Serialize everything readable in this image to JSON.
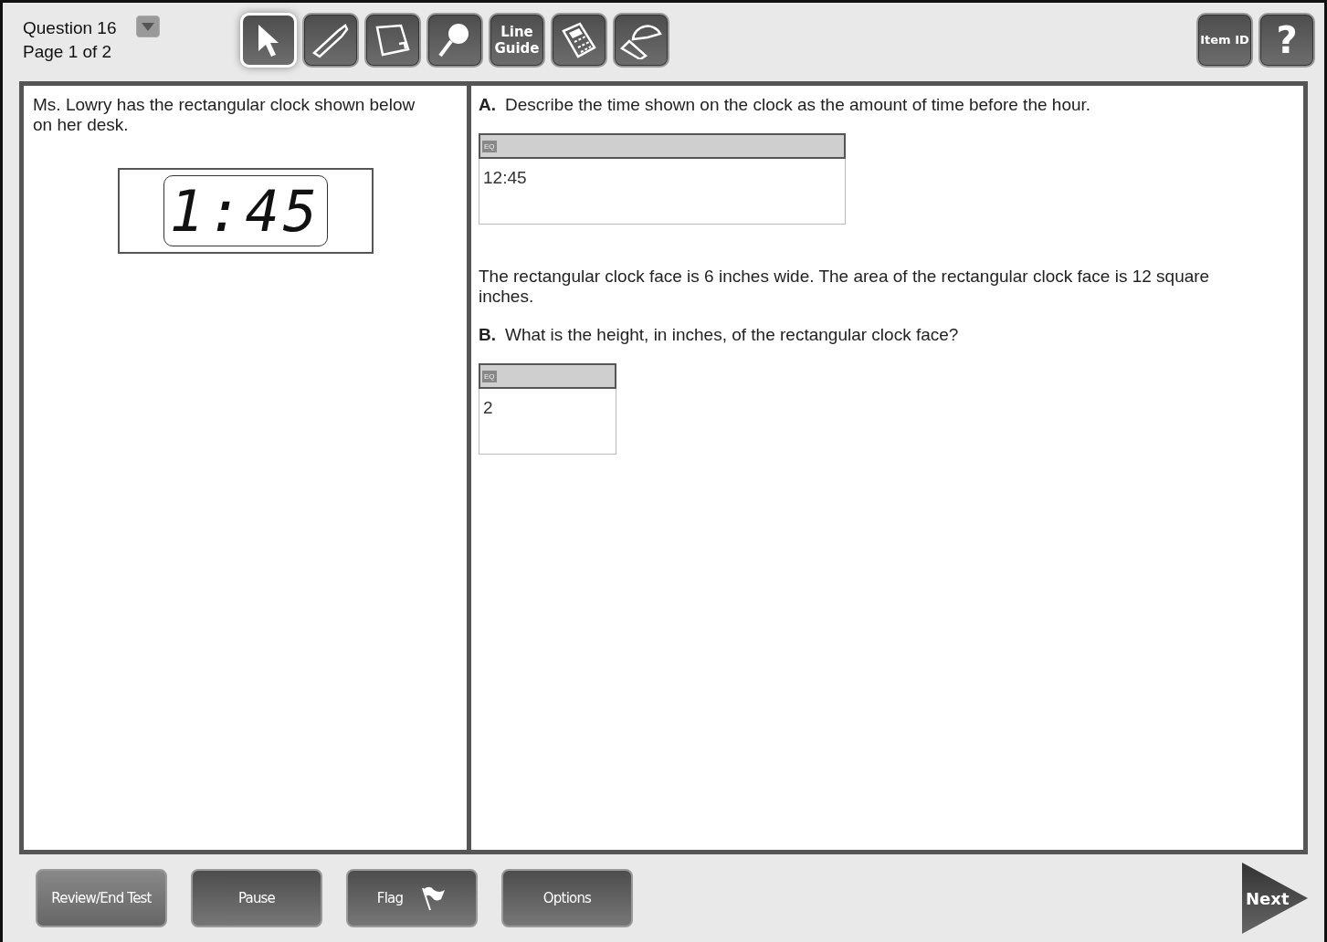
{
  "header": {
    "question": "Question 16",
    "page": "Page 1 of 2"
  },
  "tools": [
    {
      "kind": "pointer",
      "selected": true
    },
    {
      "kind": "highlighter",
      "selected": false
    },
    {
      "kind": "note",
      "selected": false
    },
    {
      "kind": "magnifier",
      "selected": false
    },
    {
      "kind": "text",
      "label": "Line Guide",
      "selected": false
    },
    {
      "kind": "calculator",
      "selected": false
    },
    {
      "kind": "protractor",
      "selected": false
    }
  ],
  "right_tools": [
    {
      "kind": "text",
      "label": "Item ID"
    },
    {
      "kind": "help",
      "label": "?"
    }
  ],
  "passage": {
    "text": "Ms. Lowry has the rectangular clock shown below on her desk.",
    "clock": "1:45"
  },
  "question": [
    {
      "kind": "prompt",
      "letter": "A.",
      "text": "Describe the time shown on the clock as the amount of time before the hour."
    },
    {
      "kind": "answer",
      "badge": "EQ",
      "value": "12:45",
      "wide": true
    },
    {
      "kind": "paragraph",
      "text": "The rectangular clock face is 6 inches wide. The area of the rectangular clock face is 12 square inches."
    },
    {
      "kind": "prompt",
      "letter": "B.",
      "text": "What is the height, in inches, of the rectangular clock face?"
    },
    {
      "kind": "answer",
      "badge": "EQ",
      "value": "2",
      "wide": false
    }
  ],
  "footer": {
    "buttons": [
      {
        "label": "Review/End Test",
        "flag": false
      },
      {
        "label": "Pause",
        "flag": false
      },
      {
        "label": "Flag",
        "flag": true
      },
      {
        "label": "Options",
        "flag": false
      }
    ],
    "next": "Next"
  }
}
